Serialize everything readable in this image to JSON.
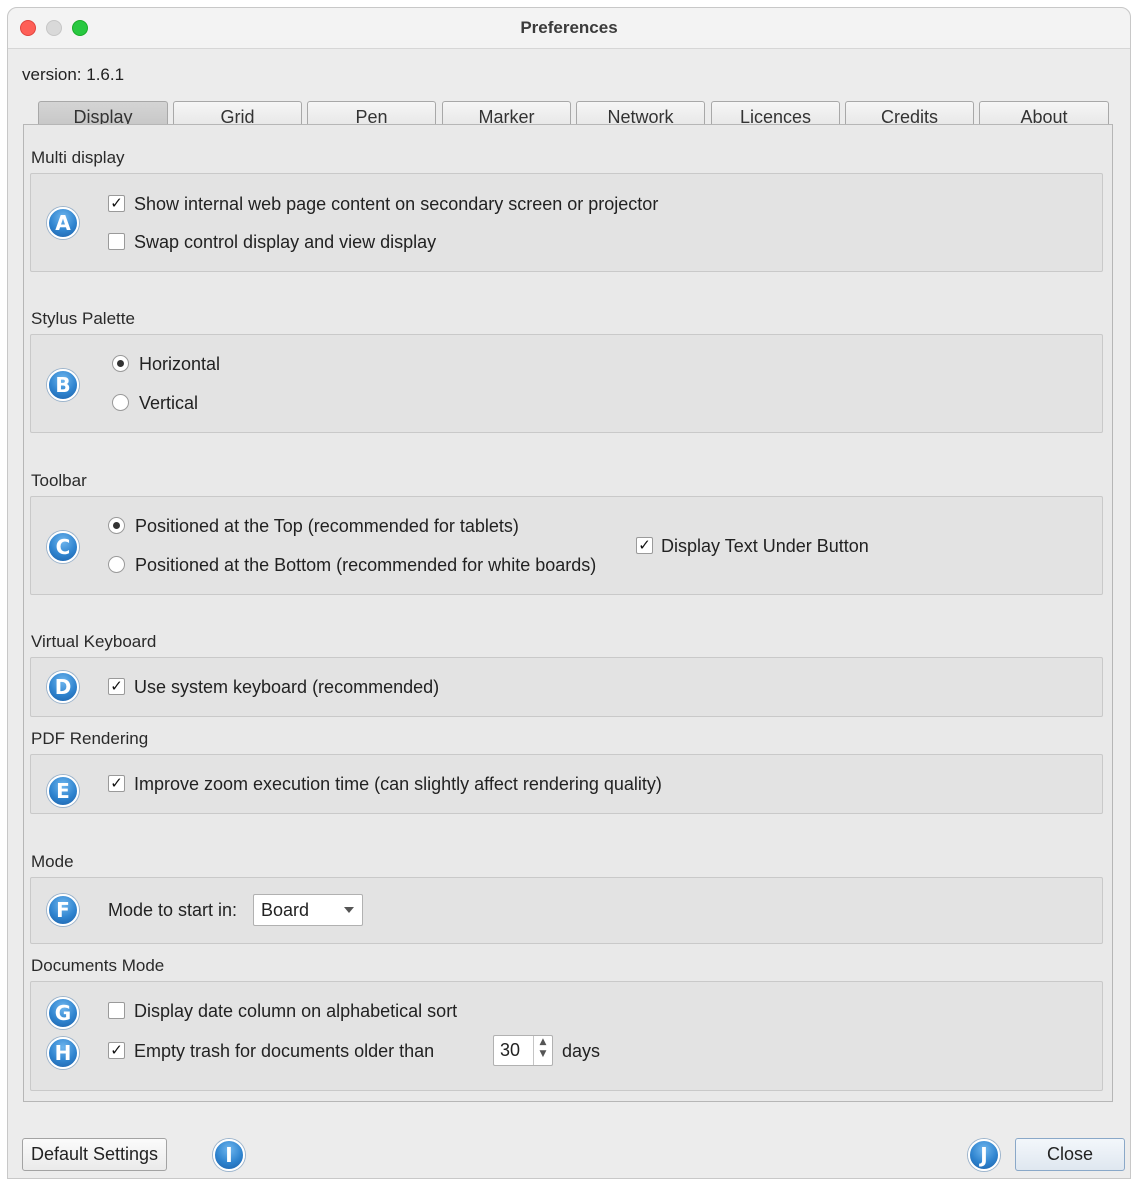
{
  "window": {
    "title": "Preferences"
  },
  "version_text": "version: 1.6.1",
  "tabs": [
    "Display",
    "Grid",
    "Pen",
    "Marker",
    "Network",
    "Licences",
    "Credits",
    "About"
  ],
  "active_tab": "Display",
  "sections": {
    "multi_display": {
      "label": "Multi display",
      "badge": "A",
      "options": [
        {
          "label": "Show internal web page content on secondary screen or projector",
          "checked": true
        },
        {
          "label": "Swap control display and view display",
          "checked": false
        }
      ]
    },
    "stylus_palette": {
      "label": "Stylus Palette",
      "badge": "B",
      "options": [
        {
          "label": "Horizontal",
          "selected": true
        },
        {
          "label": "Vertical",
          "selected": false
        }
      ]
    },
    "toolbar": {
      "label": "Toolbar",
      "badge": "C",
      "options": [
        {
          "label": "Positioned at the Top (recommended for tablets)",
          "selected": true
        },
        {
          "label": "Positioned at the Bottom (recommended for white boards)",
          "selected": false
        }
      ],
      "display_text": {
        "label": "Display Text Under Button",
        "checked": true
      }
    },
    "virtual_keyboard": {
      "label": "Virtual Keyboard",
      "badge": "D",
      "option": {
        "label": "Use system keyboard (recommended)",
        "checked": true
      }
    },
    "pdf_rendering": {
      "label": "PDF Rendering",
      "badge": "E",
      "option": {
        "label": "Improve zoom execution time (can slightly affect rendering quality)",
        "checked": true
      }
    },
    "mode": {
      "label": "Mode",
      "badge": "F",
      "start_label": "Mode to start in:",
      "start_value": "Board"
    },
    "documents_mode": {
      "label": "Documents Mode",
      "badge_date": "G",
      "badge_trash": "H",
      "date_column": {
        "label": "Display date column on alphabetical sort",
        "checked": false
      },
      "empty_trash": {
        "label": "Empty trash for documents older than",
        "checked": true,
        "value": "30",
        "unit": "days"
      }
    }
  },
  "footer": {
    "default_button": "Default Settings",
    "badge_i": "I",
    "badge_j": "J",
    "close_button": "Close"
  },
  "icons": {
    "check": "✓",
    "spin_up": "▲",
    "spin_down": "▼"
  },
  "colors": {
    "badge_blue": "#2f84cf",
    "close_red": "#fe5f57",
    "zoom_green": "#28c840"
  }
}
